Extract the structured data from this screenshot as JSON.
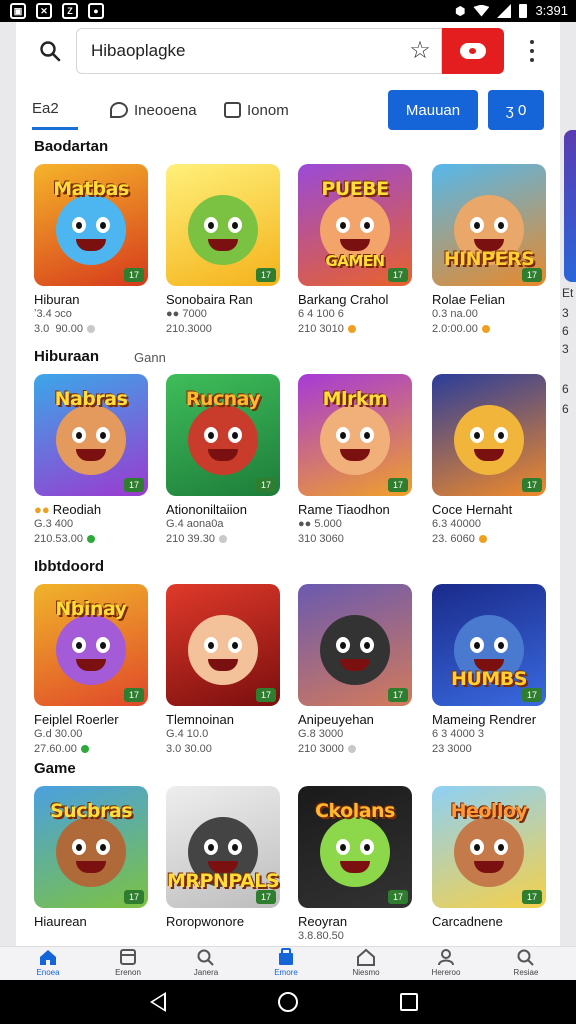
{
  "status_bar": {
    "icons": [
      "gallery-icon",
      "x-icon",
      "news-icon",
      "chat-icon"
    ],
    "right_icons": [
      "nfc-icon",
      "wifi-icon",
      "signal-icon",
      "battery-icon"
    ],
    "time": "3:391"
  },
  "search": {
    "value": "Hibaoplagke",
    "icons": {
      "search": "search-icon",
      "favorite": "star-icon",
      "red_button": "record-icon",
      "more": "more-vertical-icon"
    }
  },
  "tabs": [
    {
      "label": "Ea2",
      "icon": "list-icon",
      "active": true
    },
    {
      "label": "Ineooena",
      "icon": "chat-bubble-icon",
      "active": false
    },
    {
      "label": "Ionom",
      "icon": "message-square-icon",
      "active": false
    }
  ],
  "buttons": {
    "primary": "Mauuan",
    "secondary": "ʒ 0"
  },
  "sections": [
    {
      "title": "Baodartan",
      "sub": "",
      "cards": [
        {
          "name": "Hiburan",
          "rating": "ʼ3.4 ɔco",
          "sub": "3.0  90.00",
          "logo": "Matbas",
          "logo_pos": "top",
          "dot": "#c8c8c8",
          "bg": [
            "#f5b42a",
            "#d63a1c"
          ],
          "char": "#4db6f0",
          "logo_color": "#ffde3b"
        },
        {
          "name": "Sonobaira Ran",
          "rating": "●● 7000",
          "sub": "210.3000",
          "logo": "",
          "logo_pos": "top",
          "dot": "",
          "bg": [
            "#fff07a",
            "#f4b21b"
          ],
          "char": "#7cc242",
          "logo_color": "#ffde3b"
        },
        {
          "name": "Barkang Crahol",
          "rating": "6 4 100 6",
          "sub": "210 3010",
          "logo": "PUEBE",
          "logo2": "GAMEN",
          "logo_pos": "top",
          "dot": "#f0a020",
          "bg": [
            "#9a4ad8",
            "#e8622a"
          ],
          "char": "#f3a46a",
          "logo_color": "#ffde3b"
        },
        {
          "name": "Rolae Felian",
          "rating": "0.3 na.00",
          "sub": "2.0:00.00",
          "logo": "HINPERS",
          "logo_pos": "bottom",
          "dot": "#f0a020",
          "bg": [
            "#55b8ec",
            "#e8892a"
          ],
          "char": "#e9a76a",
          "logo_color": "#ffcf33"
        }
      ]
    },
    {
      "title": "Hiburaan",
      "sub": "Gann",
      "cards": [
        {
          "name": "Reodiah",
          "rating": "G.3 400",
          "sub": "210.53.00",
          "logo": "Nabras",
          "logo_pos": "top",
          "dot": "#2eaa3a",
          "prefix": "●●",
          "bg": [
            "#3ba7e8",
            "#9b3ad0"
          ],
          "char": "#e39a5c",
          "logo_color": "#ffde3b"
        },
        {
          "name": "Ationoniltaiion",
          "rating": "G.4 aona0a",
          "sub": "210 39.30",
          "logo": "Rucnay",
          "logo_pos": "top",
          "dot": "#c8c8c8",
          "bg": [
            "#3fbd5a",
            "#1d7d3a"
          ],
          "char": "#c93b2b",
          "logo_color": "#ffb830"
        },
        {
          "name": "Rame Tiaodhon",
          "rating": "●● 5.000",
          "sub": "310 3060",
          "logo": "Mlrkm",
          "logo_pos": "top",
          "dot": "",
          "bg": [
            "#a63ad8",
            "#f0a02a"
          ],
          "char": "#f1b07a",
          "logo_color": "#ffde3b"
        },
        {
          "name": "Coce Hernaht",
          "rating": "6.3 40000",
          "sub": "23. 6060",
          "logo": "",
          "logo_pos": "top",
          "dot": "#f0a020",
          "bg": [
            "#2b3d9a",
            "#f08a2a"
          ],
          "char": "#f0b53a",
          "logo_color": "#ffde3b"
        }
      ]
    },
    {
      "title": "Ibbtdoord",
      "sub": "",
      "cards": [
        {
          "name": "Feiplel Roerler",
          "rating": "G.d 30.00",
          "sub": "27.60.00",
          "logo": "Nbinay",
          "logo_pos": "top",
          "dot": "#2eaa3a",
          "bg": [
            "#f0b42a",
            "#e0482a"
          ],
          "char": "#a35bd8",
          "logo_color": "#ffde3b"
        },
        {
          "name": "Tlemnoinan",
          "rating": "G.4 10.0",
          "sub": "3.0 30.00",
          "logo": "",
          "logo_pos": "top",
          "dot": "",
          "bg": [
            "#e03a2a",
            "#7a0e0e"
          ],
          "char": "#f3c19a",
          "logo_color": "#ffde3b"
        },
        {
          "name": "Anipeuyehan",
          "rating": "G.8 3000",
          "sub": "210 3000",
          "logo": "",
          "logo_pos": "top",
          "dot": "#c8c8c8",
          "bg": [
            "#6a5ab0",
            "#d37a5a"
          ],
          "char": "#333333",
          "logo_color": "#ffde3b"
        },
        {
          "name": "Mameing Rendrer",
          "rating": "6 3 4000 3",
          "sub": "23 3000",
          "logo": "HUMBS",
          "logo_pos": "bottom",
          "dot": "",
          "bg": [
            "#1a2a8a",
            "#3a6ae0"
          ],
          "char": "#4a7ad0",
          "logo_color": "#ffcf33"
        }
      ]
    },
    {
      "title": "Game",
      "sub": "",
      "cards": [
        {
          "name": "Hiaurean",
          "rating": "",
          "sub": "",
          "logo": "Sucbras",
          "logo_pos": "top",
          "dot": "",
          "bg": [
            "#4aa0e0",
            "#7cc242"
          ],
          "char": "#b06a3a",
          "logo_color": "#ffde3b"
        },
        {
          "name": "Roropwonore",
          "rating": "",
          "sub": "",
          "logo": "MRPNPALS",
          "logo_pos": "bottom",
          "dot": "",
          "bg": [
            "#eeeeee",
            "#bdbdbd"
          ],
          "char": "#444444",
          "logo_color": "#ffde3b"
        },
        {
          "name": "Reoyran",
          "rating": "3.8.80.50",
          "sub": "",
          "logo": "Ckolans",
          "logo_pos": "top",
          "dot": "",
          "bg": [
            "#1a1a1a",
            "#333333"
          ],
          "char": "#8cd84a",
          "logo_color": "#ffb830"
        },
        {
          "name": "Carcadnene",
          "rating": "",
          "sub": "",
          "logo": "Heolloy",
          "logo_pos": "top",
          "dot": "",
          "bg": [
            "#8ed0f5",
            "#f5d04a"
          ],
          "char": "#c47a4a",
          "logo_color": "#ff9a3a"
        }
      ]
    }
  ],
  "peek_text": [
    "Et",
    "3",
    "6",
    "3",
    "6",
    "6"
  ],
  "bottom_nav": [
    {
      "label": "Enoea",
      "icon": "home-icon",
      "active": true
    },
    {
      "label": "Erenon",
      "icon": "book-icon",
      "active": false
    },
    {
      "label": "Janera",
      "icon": "search-icon",
      "active": false
    },
    {
      "label": "Emore",
      "icon": "store-icon",
      "active": true
    },
    {
      "label": "Niesmo",
      "icon": "house-outline-icon",
      "active": false
    },
    {
      "label": "Hereroo",
      "icon": "profile-icon",
      "active": false
    },
    {
      "label": "Resiae",
      "icon": "search-alt-icon",
      "active": false
    }
  ],
  "colors": {
    "accent": "#1565d8",
    "red": "#e41e1e"
  }
}
